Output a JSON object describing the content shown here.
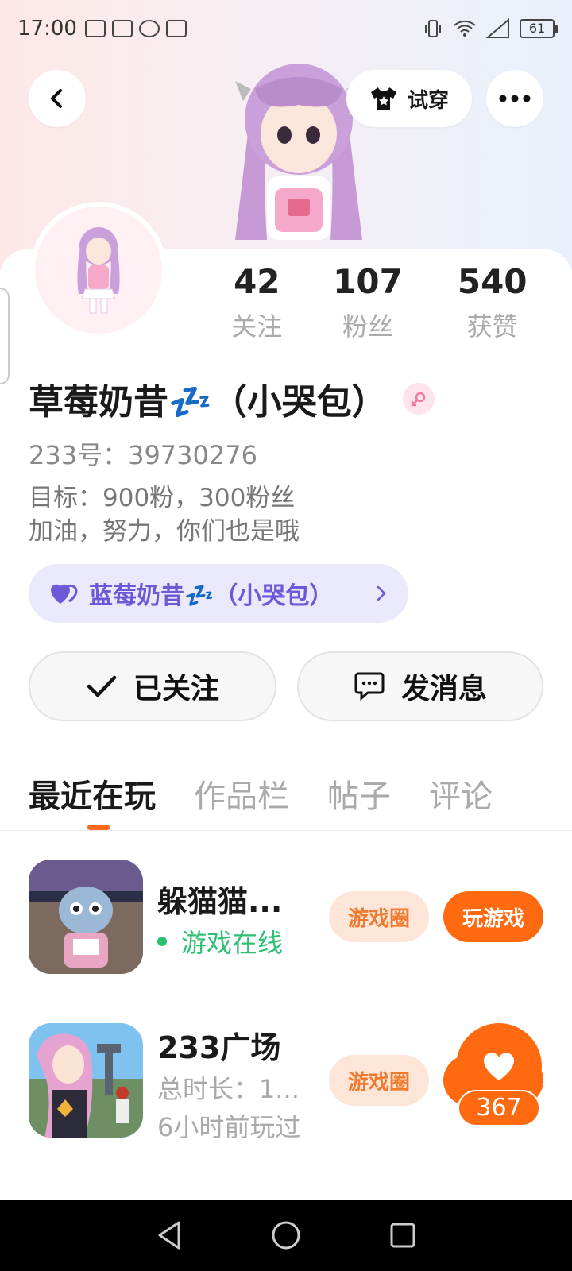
{
  "status_bar": {
    "time": "17:00",
    "battery": "61"
  },
  "header": {
    "try_on_label": "试穿"
  },
  "stats": [
    {
      "value": "42",
      "label": "关注"
    },
    {
      "value": "107",
      "label": "粉丝"
    },
    {
      "value": "540",
      "label": "获赞"
    }
  ],
  "profile": {
    "name": "草莓奶昔💤（小哭包）",
    "uid": "233号：39730276",
    "bio_line1": "目标：900粉，300粉丝",
    "bio_line2": "加油，努力，你们也是哦",
    "group_label": "蓝莓奶昔💤（小哭包）"
  },
  "actions": {
    "follow_label": "已关注",
    "message_label": "发消息"
  },
  "tabs": [
    {
      "label": "最近在玩"
    },
    {
      "label": "作品栏"
    },
    {
      "label": "帖子"
    },
    {
      "label": "评论"
    }
  ],
  "games": [
    {
      "title": "躲猫猫...",
      "status": "游戏在线",
      "circle_label": "游戏圈",
      "play_label": "玩游戏"
    },
    {
      "title": "233广场",
      "duration": "总时长：1...",
      "last_played": "6小时前玩过",
      "circle_label": "游戏圈"
    }
  ],
  "like": {
    "count": "367"
  },
  "colors": {
    "accent": "#ff6a10",
    "online": "#2dbf72",
    "group": "#6a5ad8"
  }
}
